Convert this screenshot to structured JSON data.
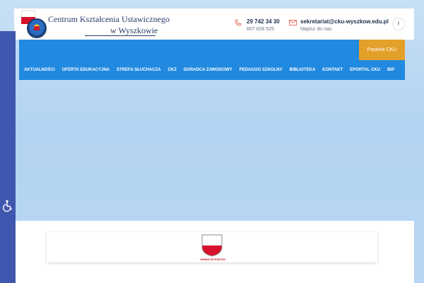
{
  "header": {
    "logo": {
      "line1": "Centrum Kształcenia Ustawicznego",
      "line2": "w Wyszkowie"
    },
    "phone": {
      "number": "29 742 34 30",
      "alt_number": "607 828 525",
      "icon": "phone-icon"
    },
    "email": {
      "address": "sekretariat@cku-wyszkow.edu.pl",
      "label": "Napisz do nas",
      "icon": "mail-icon"
    },
    "social": {
      "facebook": "f"
    }
  },
  "cta": {
    "label": "Pasieka CKU"
  },
  "nav": {
    "items": [
      "AKTUALNOŚCI",
      "OFERTA EDUKACYJNA",
      "STREFA SŁUCHACZA",
      "CKZ",
      "DORADCA ZAWODOWY",
      "PEDAGOG SZKOLNY",
      "BIBLIOTEKA",
      "KONTAKT",
      "EPORTAL CKU",
      "BIP"
    ]
  },
  "partners": {
    "gmina_label": "GMINA WYSZKÓW"
  },
  "colors": {
    "nav_blue": "#2189df",
    "cta_orange": "#e3a12a",
    "accessibility_blue": "#3f57ae",
    "flag_red": "#d8102c"
  },
  "accessibility": {
    "icon": "wheelchair-icon"
  }
}
